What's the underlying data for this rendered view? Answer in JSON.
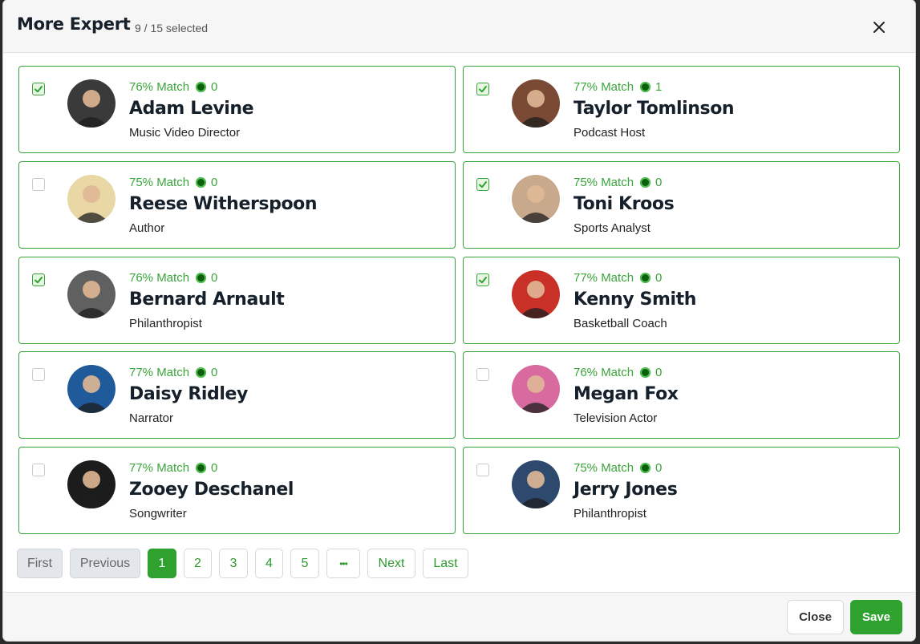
{
  "modal": {
    "title": "More Expert",
    "selection_count": "9 / 15 selected",
    "close_icon": "close-icon"
  },
  "experts": [
    {
      "match": "76% Match",
      "count": "0",
      "name": "Adam Levine",
      "role": "Music Video Director",
      "selected": true,
      "avatar_color": "#3a3a3a"
    },
    {
      "match": "77% Match",
      "count": "1",
      "name": "Taylor Tomlinson",
      "role": "Podcast Host",
      "selected": true,
      "avatar_color": "#7a4a35"
    },
    {
      "match": "75% Match",
      "count": "0",
      "name": "Reese Witherspoon",
      "role": "Author",
      "selected": false,
      "avatar_color": "#e9d7a6"
    },
    {
      "match": "75% Match",
      "count": "0",
      "name": "Toni Kroos",
      "role": "Sports Analyst",
      "selected": true,
      "avatar_color": "#c9a98b"
    },
    {
      "match": "76% Match",
      "count": "0",
      "name": "Bernard Arnault",
      "role": "Philanthropist",
      "selected": true,
      "avatar_color": "#606060"
    },
    {
      "match": "77% Match",
      "count": "0",
      "name": "Kenny Smith",
      "role": "Basketball Coach",
      "selected": true,
      "avatar_color": "#c83028"
    },
    {
      "match": "77% Match",
      "count": "0",
      "name": "Daisy Ridley",
      "role": "Narrator",
      "selected": false,
      "avatar_color": "#1f5a9a"
    },
    {
      "match": "76% Match",
      "count": "0",
      "name": "Megan Fox",
      "role": "Television Actor",
      "selected": false,
      "avatar_color": "#d86aa0"
    },
    {
      "match": "77% Match",
      "count": "0",
      "name": "Zooey Deschanel",
      "role": "Songwriter",
      "selected": false,
      "avatar_color": "#1c1c1c"
    },
    {
      "match": "75% Match",
      "count": "0",
      "name": "Jerry Jones",
      "role": "Philanthropist",
      "selected": false,
      "avatar_color": "#2d4a6e"
    }
  ],
  "pagination": {
    "first": "First",
    "previous": "Previous",
    "pages": [
      "1",
      "2",
      "3",
      "4",
      "5"
    ],
    "ellipsis": "•••",
    "next": "Next",
    "last": "Last",
    "current": "1"
  },
  "footer": {
    "close_label": "Close",
    "save_label": "Save"
  },
  "colors": {
    "accent": "#2ea12e",
    "card_border": "#3aa53a",
    "match_text": "#3aa53a"
  }
}
